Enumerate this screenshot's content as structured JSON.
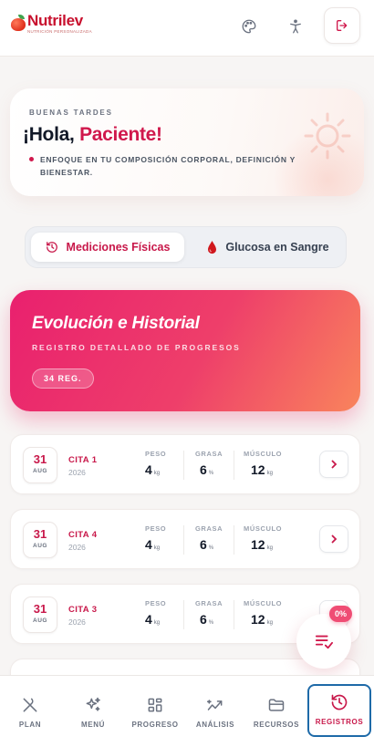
{
  "header": {
    "logo_name": "Nutrilev",
    "logo_sub": "NUTRICIÓN PERSONALIZADA",
    "icons": [
      "palette-icon",
      "accessibility-icon",
      "logout-icon"
    ]
  },
  "greeting": {
    "small": "BUENAS TARDES",
    "hello": "¡Hola, ",
    "name": "Paciente!",
    "focus": "ENFOQUE EN TU COMPOSICIÓN CORPORAL, DEFINICIÓN Y BIENESTAR."
  },
  "tabs": [
    {
      "label": "Mediciones Físicas",
      "icon": "history-icon",
      "active": true
    },
    {
      "label": "Glucosa en Sangre",
      "icon": "blood-drop-icon",
      "active": false
    }
  ],
  "hero": {
    "title": "Evolución e Historial",
    "subtitle": "REGISTRO DETALLADO DE PROGRESOS",
    "badge": "34 REG."
  },
  "metric_labels": {
    "peso": "PESO",
    "grasa": "GRASA",
    "musculo": "MÚSCULO"
  },
  "units": {
    "peso": "kg",
    "grasa": "%",
    "musculo": "kg"
  },
  "records": [
    {
      "day": "31",
      "month": "AUG",
      "cita": "CITA 1",
      "year": "2026",
      "peso": "4",
      "grasa": "6",
      "musculo": "12"
    },
    {
      "day": "31",
      "month": "AUG",
      "cita": "CITA 4",
      "year": "2026",
      "peso": "4",
      "grasa": "6",
      "musculo": "12"
    },
    {
      "day": "31",
      "month": "AUG",
      "cita": "CITA 3",
      "year": "2026",
      "peso": "4",
      "grasa": "6",
      "musculo": "12"
    }
  ],
  "fab": {
    "badge": "0%",
    "icon": "list-check-icon"
  },
  "nav": [
    {
      "label": "PLAN",
      "icon": "utensils-icon"
    },
    {
      "label": "MENÚ",
      "icon": "sparkles-icon"
    },
    {
      "label": "PROGRESO",
      "icon": "grid-icon"
    },
    {
      "label": "ANÁLISIS",
      "icon": "trend-icon"
    },
    {
      "label": "RECURSOS",
      "icon": "folder-icon"
    },
    {
      "label": "REGISTROS",
      "icon": "history-icon",
      "active": true
    }
  ],
  "colors": {
    "accent": "#c8184a",
    "hero_start": "#e9206e",
    "hero_end": "#f9845c",
    "nav_focus": "#1e6aa8"
  }
}
